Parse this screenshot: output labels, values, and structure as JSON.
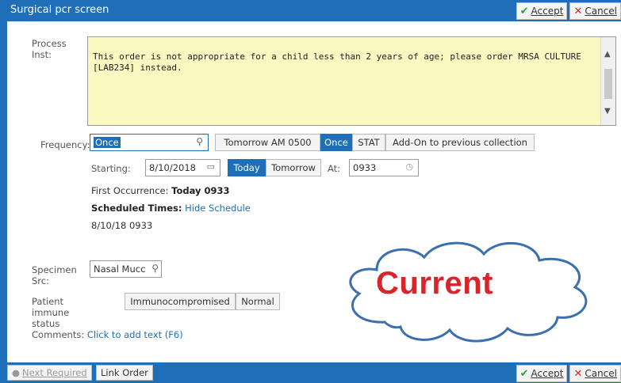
{
  "window": {
    "title": "Surgical pcr screen"
  },
  "actions": {
    "accept_label": "Accept",
    "cancel_label": "Cancel",
    "accept_hotkey": "A",
    "cancel_hotkey": "C"
  },
  "process": {
    "label": "Process Inst:",
    "text": "This order is not appropriate for a child less than 2 years of age; please order MRSA CULTURE [LAB234] instead."
  },
  "frequency": {
    "label": "Frequency:",
    "value": "Once",
    "options": [
      "Tomorrow AM 0500",
      "Once",
      "STAT",
      "Add-On to previous collection"
    ],
    "selected": "Once"
  },
  "starting": {
    "label": "Starting:",
    "date": "8/10/2018",
    "today_label": "Today",
    "tomorrow_label": "Tomorrow",
    "at_label": "At:",
    "time": "0933"
  },
  "first_occurrence": {
    "label": "First Occurrence:",
    "value": "Today 0933"
  },
  "schedule": {
    "label": "Scheduled Times:",
    "link": "Hide Schedule",
    "time": "8/10/18 0933"
  },
  "specimen": {
    "label": "Specimen Src:",
    "value": "Nasal Mucc"
  },
  "immune": {
    "label": "Patient immune status",
    "options": [
      "Immunocompromised",
      "Normal"
    ]
  },
  "comments": {
    "label": "Comments:",
    "link": "Click to add text (F6)"
  },
  "bottom": {
    "next_required": "Next Required",
    "link_order": "Link Order"
  },
  "annotation": {
    "text": "Current"
  },
  "colors": {
    "accent": "#1e6fb8",
    "note_bg": "#fbf8c1",
    "annotation": "#d8242a"
  }
}
